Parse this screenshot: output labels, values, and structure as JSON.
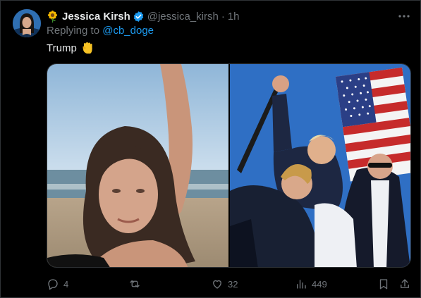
{
  "tweet": {
    "display_name": "Jessica Kirsh",
    "handle": "@jessica_kirsh",
    "separator": "·",
    "time": "1h",
    "replying_prefix": "Replying to",
    "replying_to": "@cb_doge",
    "text": "Trump",
    "emoji_name": "raised-fist"
  },
  "actions": {
    "replies": "4",
    "likes": "32",
    "views": "449"
  },
  "colors": {
    "background": "#000000",
    "text": "#e7e9ea",
    "muted": "#71767b",
    "accent": "#1d9bf0"
  },
  "icons": [
    "sunflower-icon",
    "verified-badge-icon",
    "more-icon",
    "raised-fist-icon",
    "reply-icon",
    "retweet-icon",
    "like-icon",
    "views-icon",
    "bookmark-icon",
    "share-icon"
  ]
}
